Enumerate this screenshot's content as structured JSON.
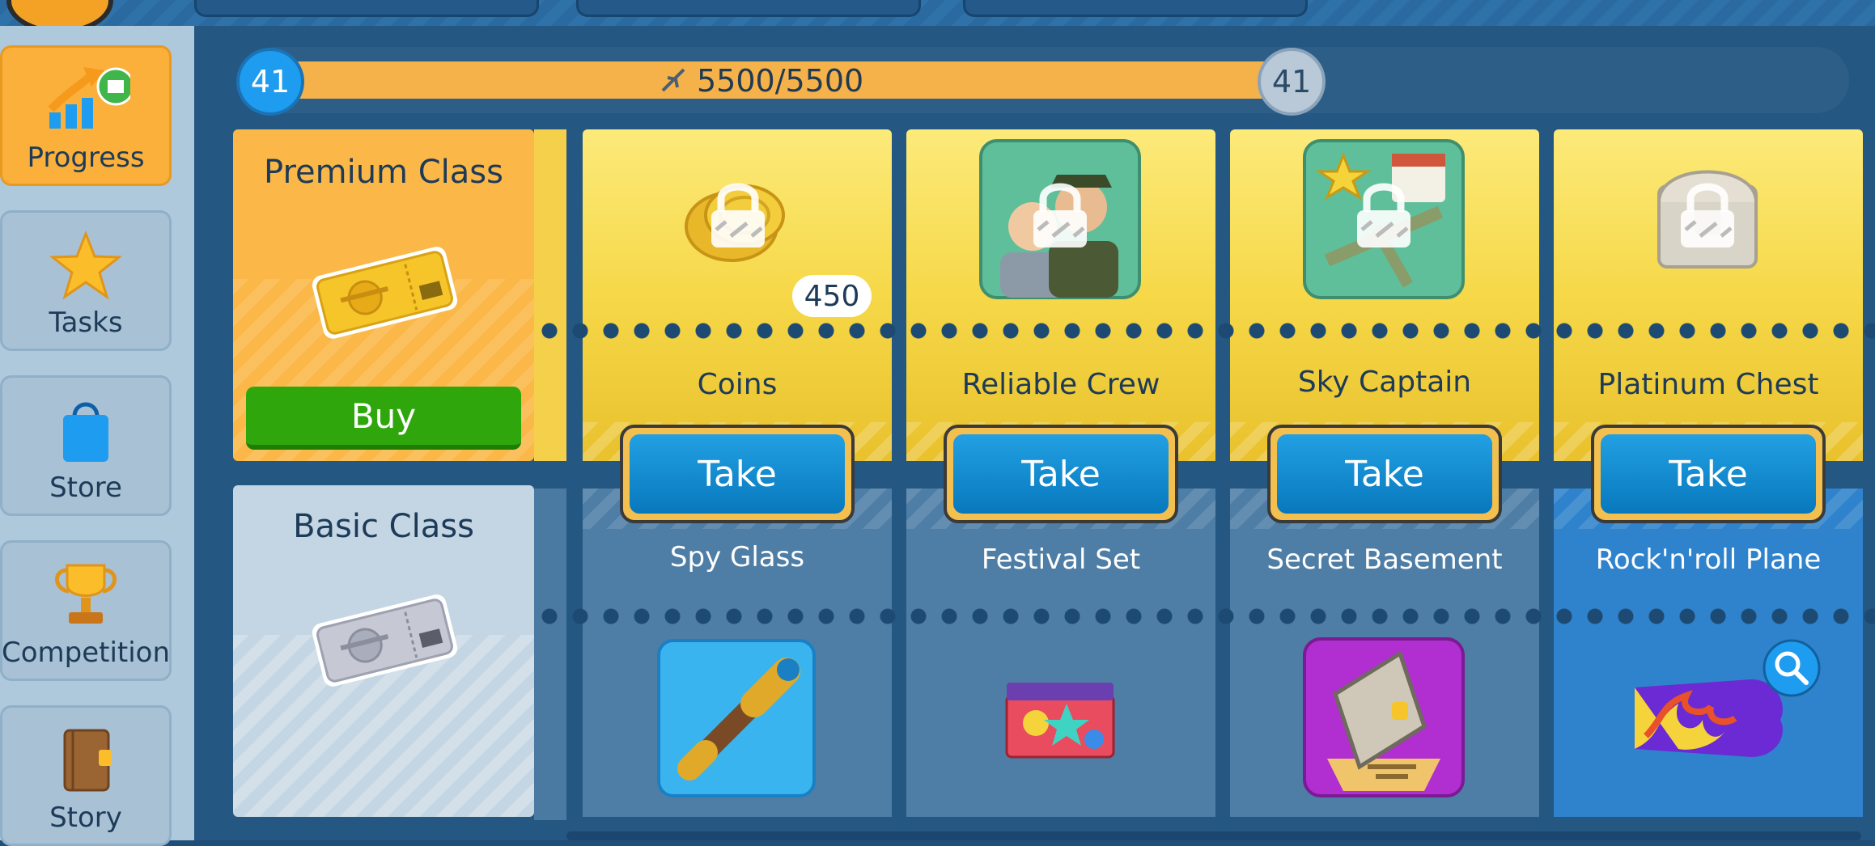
{
  "sidebar": {
    "items": [
      {
        "label": "Progress",
        "icon": "progress-arrow-icon",
        "active": true
      },
      {
        "label": "Tasks",
        "icon": "star-icon",
        "active": false
      },
      {
        "label": "Store",
        "icon": "shopping-bag-icon",
        "active": false
      },
      {
        "label": "Competition",
        "icon": "trophy-icon",
        "active": false
      },
      {
        "label": "Story",
        "icon": "book-icon",
        "active": false
      }
    ]
  },
  "progress": {
    "current_level": "41",
    "next_level": "41",
    "xp_text": "5500/5500",
    "fill_fraction": 1.0
  },
  "tiers": {
    "premium": {
      "title": "Premium Class",
      "buy_label": "Buy",
      "icon": "gold-ticket-icon"
    },
    "basic": {
      "title": "Basic Class",
      "icon": "silver-ticket-icon"
    }
  },
  "rewards": [
    {
      "premium_label": "Coins",
      "premium_icon": "coins-icon",
      "premium_badge": "450",
      "take_label": "Take",
      "basic_label": "Spy Glass",
      "basic_icon": "spyglass-icon"
    },
    {
      "premium_label": "Reliable Crew",
      "premium_icon": "crew-icon",
      "take_label": "Take",
      "basic_label": "Festival Set",
      "basic_icon": "festival-set-icon"
    },
    {
      "premium_label": "Sky Captain",
      "premium_icon": "sky-captain-icon",
      "take_label": "Take",
      "basic_label": "Secret Basement",
      "basic_icon": "secret-basement-icon"
    },
    {
      "premium_label": "Platinum Chest",
      "premium_icon": "platinum-chest-icon",
      "take_label": "Take",
      "basic_label": "Rock'n'roll Plane",
      "basic_icon": "flame-plane-icon"
    }
  ],
  "colors": {
    "premium_bg": "#fbb848",
    "reward_top": "#f6d848",
    "take_button": "#0f8ad0",
    "buy_button": "#2fa70c",
    "level_badge": "#1e9cf0"
  }
}
